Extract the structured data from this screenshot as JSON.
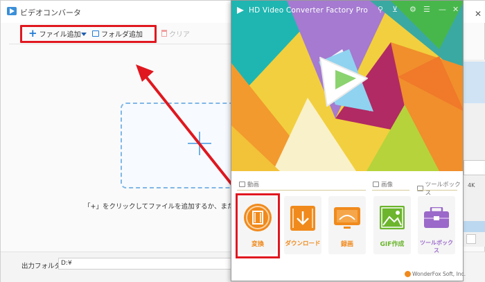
{
  "bg_window": {
    "title": "ビデオコンバータ",
    "toolbar": {
      "add_file": "ファイル追加",
      "add_folder": "フォルダ追加",
      "clear": "クリア"
    },
    "drop_hint": "「+」をクリックしてファイルを追加するか、またはファイ",
    "output_folder_label": "出力フォルダ：",
    "output_folder_value": "D:¥",
    "side_4k": "4K"
  },
  "fg_window": {
    "title": "HD Video Converter Factory Pro",
    "sections": {
      "video": "動画",
      "image": "画像",
      "toolbox": "ツールボックス"
    },
    "tiles": {
      "convert": "変換",
      "download": "ダウンロード",
      "record": "録画",
      "gif": "GIF作成",
      "toolbox": "ツールボックス"
    },
    "brand": "WonderFox Soft, Inc."
  },
  "colors": {
    "highlight_red": "#e0171f",
    "accent_orange": "#f08a1c",
    "accent_green": "#6cb52d",
    "accent_purple": "#9b69c9"
  }
}
